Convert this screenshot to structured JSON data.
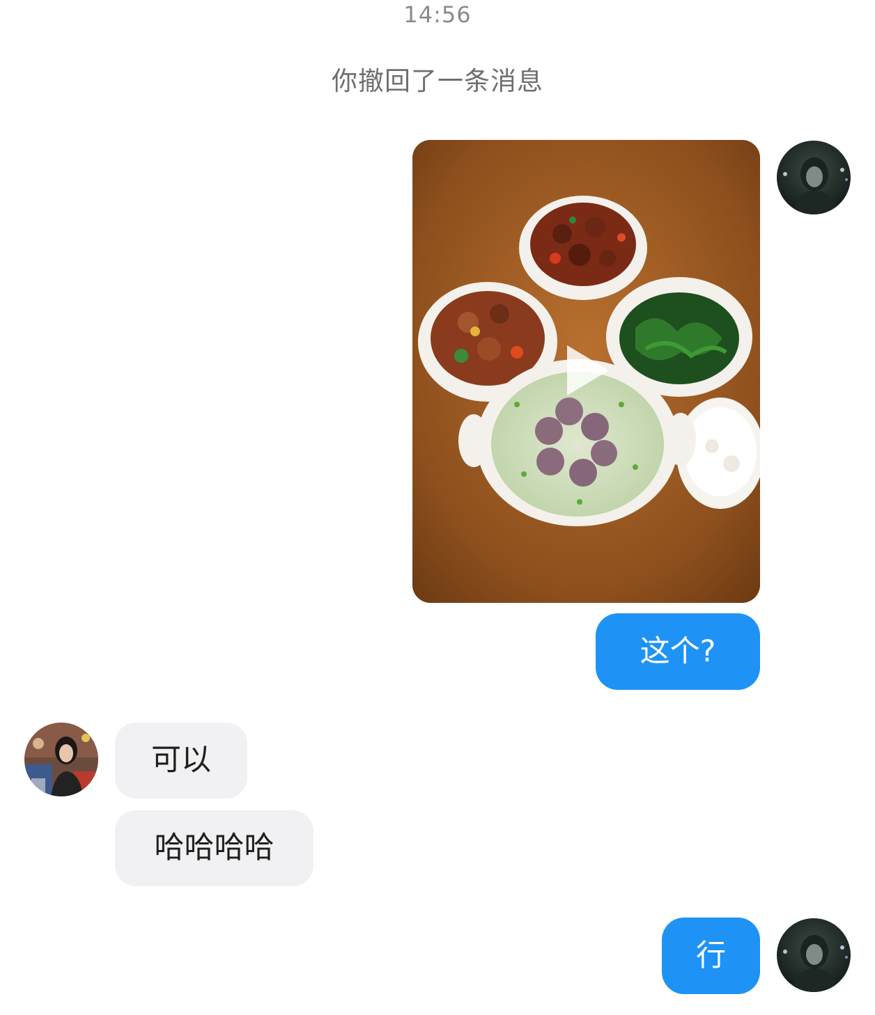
{
  "chat": {
    "timestamp": "14:56",
    "system_note": "你撤回了一条消息",
    "messages": [
      {
        "sender": "me",
        "type": "video",
        "thumbnail_description": "home-cooked dishes on a wooden table",
        "icon": "play-icon"
      },
      {
        "sender": "me",
        "type": "text",
        "text": "这个?"
      },
      {
        "sender": "other",
        "type": "text",
        "text": "可以"
      },
      {
        "sender": "other",
        "type": "text",
        "text": "哈哈哈哈"
      },
      {
        "sender": "me",
        "type": "text",
        "text": "行"
      }
    ]
  },
  "colors": {
    "outgoing_bubble": "#1e93f5",
    "incoming_bubble": "#f1f1f3",
    "timestamp_text": "#8a8a8a",
    "system_text": "#6f6f6f"
  }
}
